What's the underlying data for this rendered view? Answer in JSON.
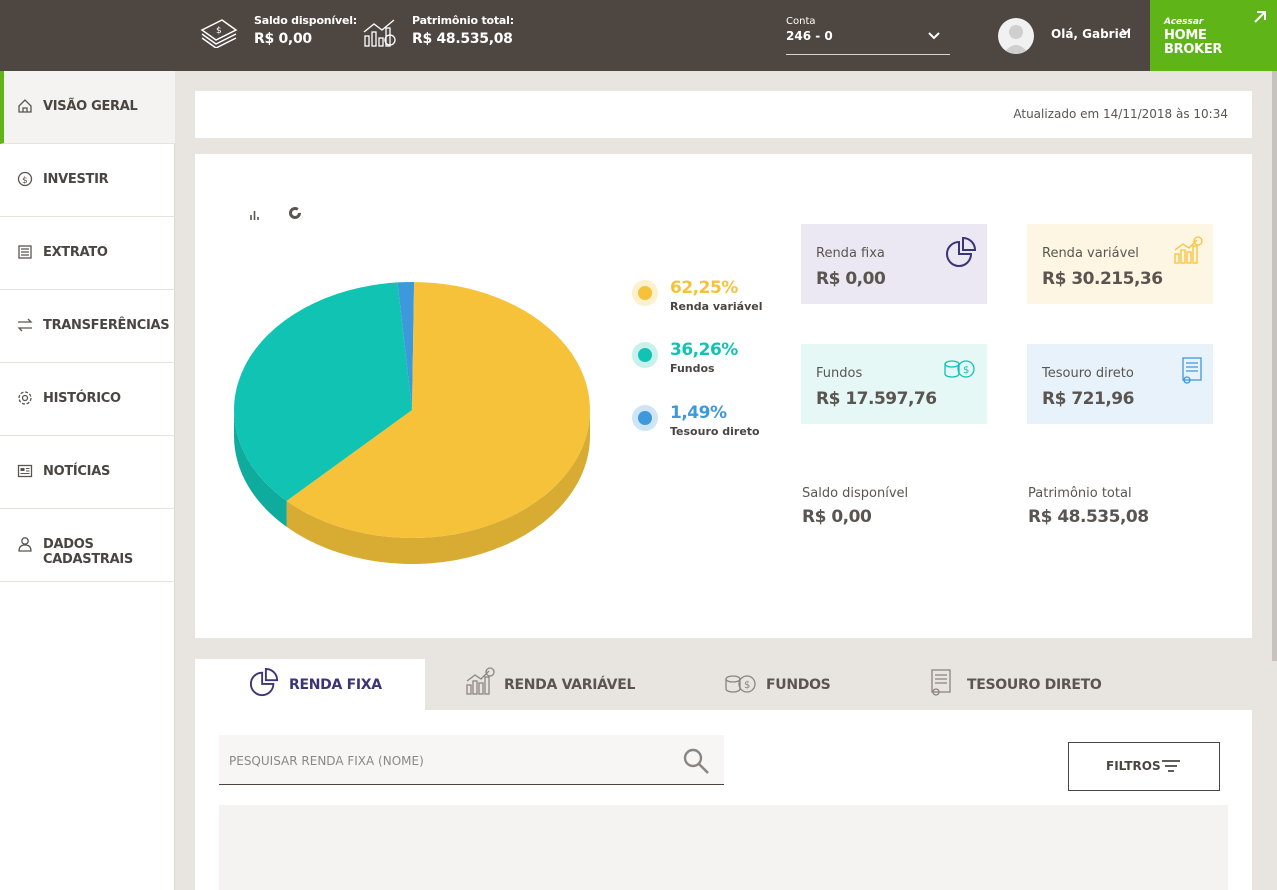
{
  "topbar": {
    "saldo_label": "Saldo disponível:",
    "saldo_value": "R$ 0,00",
    "patrimonio_label": "Patrimônio total:",
    "patrimonio_value": "R$ 48.535,08",
    "conta_label": "Conta",
    "conta_value": "246 - 0",
    "greeting": "Olá, Gabriel",
    "home_broker_pre": "Acessar",
    "home_broker_line1": "HOME",
    "home_broker_line2": "BROKER"
  },
  "sidebar": {
    "items": [
      {
        "label": "VISÃO GERAL",
        "icon": "home-icon",
        "active": true
      },
      {
        "label": "INVESTIR",
        "icon": "coin-icon"
      },
      {
        "label": "EXTRATO",
        "icon": "list-icon"
      },
      {
        "label": "TRANSFERÊNCIAS",
        "icon": "transfer-icon"
      },
      {
        "label": "HISTÓRICO",
        "icon": "gear-icon"
      },
      {
        "label": "NOTÍCIAS",
        "icon": "news-icon"
      },
      {
        "label": "DADOS CADASTRAIS",
        "icon": "user-icon"
      }
    ]
  },
  "updated": "Atualizado em 14/11/2018 às 10:34",
  "legend": [
    {
      "pct": "62,25%",
      "name": "Renda variável",
      "color": "#f5c23a"
    },
    {
      "pct": "36,26%",
      "name": "Fundos",
      "color": "#11c3b2"
    },
    {
      "pct": "1,49%",
      "name": "Tesouro direto",
      "color": "#3e98dc"
    }
  ],
  "categories": {
    "renda_fixa": {
      "name": "Renda fixa",
      "value": "R$ 0,00"
    },
    "renda_variavel": {
      "name": "Renda variável",
      "value": "R$ 30.215,36"
    },
    "fundos": {
      "name": "Fundos",
      "value": "R$ 17.597,76"
    },
    "tesouro": {
      "name": "Tesouro direto",
      "value": "R$ 721,96"
    }
  },
  "summary": {
    "saldo_label": "Saldo disponível",
    "saldo_value": "R$ 0,00",
    "patrimonio_label": "Patrimônio total",
    "patrimonio_value": "R$ 48.535,08"
  },
  "tabs": [
    {
      "label": "RENDA FIXA",
      "active": true
    },
    {
      "label": "RENDA VARIÁVEL"
    },
    {
      "label": "FUNDOS"
    },
    {
      "label": "TESOURO DIRETO"
    }
  ],
  "search": {
    "placeholder": "PESQUISAR RENDA FIXA (NOME)"
  },
  "filters_label": "FILTROS",
  "colors": {
    "topbar": "#4e4641",
    "accent_green": "#5fb418",
    "renda_variavel": "#f5c23a",
    "fundos": "#11c3b2",
    "tesouro": "#3e98dc",
    "renda_fixa_purple": "#3b3575"
  },
  "chart_data": {
    "type": "pie",
    "categories": [
      "Renda variável",
      "Fundos",
      "Tesouro direto"
    ],
    "values": [
      62.25,
      36.26,
      1.49
    ],
    "colors": [
      "#f5c23a",
      "#11c3b2",
      "#3e98dc"
    ]
  }
}
